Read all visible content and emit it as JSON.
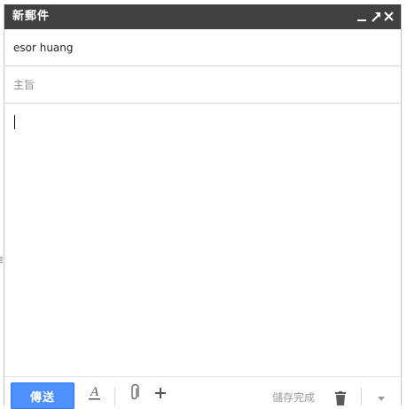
{
  "window": {
    "title": "新郵件",
    "controls": [
      "minimize-icon",
      "expand-icon",
      "close-icon"
    ]
  },
  "recipients": {
    "to_value": "esor huang"
  },
  "subject": {
    "placeholder": "主旨"
  },
  "toolbar": {
    "send_label": "傳送",
    "format_icon": "text-format-icon",
    "attach_icon": "paperclip-icon",
    "more_icon": "plus-icon",
    "save_status": "儲存完成",
    "trash_icon": "trash-icon",
    "options_icon": "chevron-down-icon"
  },
  "colors": {
    "titlebar": "#404040",
    "send_button": "#4d90fe",
    "text": "#222222",
    "muted": "#9a9a9a"
  }
}
